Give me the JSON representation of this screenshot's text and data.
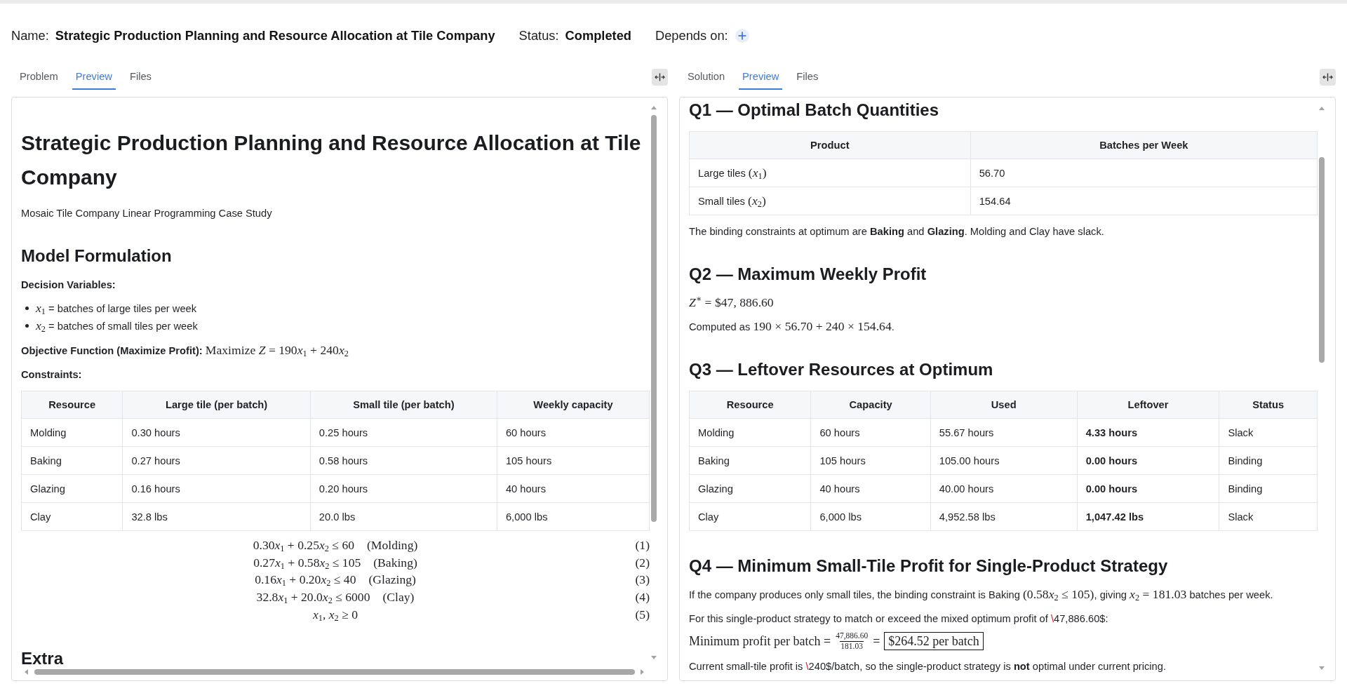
{
  "header": {
    "name_label": "Name:",
    "name": "Strategic Production Planning and Resource Allocation at Tile Company",
    "status_label": "Status:",
    "status": "Completed",
    "depends_label": "Depends on:"
  },
  "left_panel": {
    "tabs": [
      {
        "label": "Problem",
        "selected": false
      },
      {
        "label": "Preview",
        "selected": true
      },
      {
        "label": "Files",
        "selected": false
      }
    ],
    "blocks": [
      {
        "kind": "title",
        "text": "Strategic Production Planning and Resource Allocation at Tile Company"
      },
      {
        "kind": "paragraph",
        "segments": [
          {
            "kind": "text",
            "text": "Mosaic Tile Company Linear Programming Case Study"
          }
        ]
      },
      {
        "kind": "heading",
        "text": "Model Formulation"
      },
      {
        "kind": "label",
        "text": "Decision Variables:"
      },
      {
        "kind": "list",
        "items": [
          {
            "segments": [
              {
                "kind": "math",
                "text": "*x*$_{1}$"
              },
              {
                "kind": "text",
                "text": " = batches of large tiles per week"
              }
            ]
          },
          {
            "segments": [
              {
                "kind": "math",
                "text": "*x*$_{2}$"
              },
              {
                "kind": "text",
                "text": " = batches of small tiles per week"
              }
            ]
          }
        ]
      },
      {
        "kind": "paragraph",
        "segments": [
          {
            "kind": "text",
            "text": "**Objective Function (Maximize Profit):** "
          },
          {
            "kind": "math",
            "text": "Maximize *Z* = 190"
          },
          {
            "kind": "math",
            "text": "*x*$_{1}$ + 240"
          },
          {
            "kind": "math",
            "text": "*x*$_{2}$"
          }
        ]
      },
      {
        "kind": "label",
        "text": "Constraints:"
      },
      {
        "kind": "table",
        "columns": [
          {
            "label": "Resource",
            "emphasis": false
          },
          {
            "label": "Large tile (per batch)",
            "emphasis": false
          },
          {
            "label": "Small tile (per batch)",
            "emphasis": false
          },
          {
            "label": "Weekly capacity",
            "emphasis": false
          }
        ],
        "rows": [
          [
            "Molding",
            "0.30 hours",
            "0.25 hours",
            "60 hours"
          ],
          [
            "Baking",
            "0.27 hours",
            "0.58 hours",
            "105 hours"
          ],
          [
            "Glazing",
            "0.16 hours",
            "0.20 hours",
            "40 hours"
          ],
          [
            "Clay",
            "32.8 lbs",
            "20.0 lbs",
            "6,000 lbs"
          ]
        ]
      },
      {
        "kind": "equations",
        "items": [
          {
            "pieces": [
              "0.30",
              "*x*$_{1}$ + 0.25",
              "*x*$_{2}$ ≤ 60"
            ],
            "tag": "(Molding)",
            "number": "(1)"
          },
          {
            "pieces": [
              "0.27",
              "*x*$_{1}$ + 0.58",
              "*x*$_{2}$ ≤ 105"
            ],
            "tag": "(Baking)",
            "number": "(2)"
          },
          {
            "pieces": [
              "0.16",
              "*x*$_{1}$ + 0.20",
              "*x*$_{2}$ ≤ 40"
            ],
            "tag": "(Glazing)",
            "number": "(3)"
          },
          {
            "pieces": [
              "32.8",
              "*x*$_{1}$ + 20.0",
              "*x*$_{2}$ ≤ 6000"
            ],
            "tag": "(Clay)",
            "number": "(4)"
          },
          {
            "pieces": [
              "*x*$_{1}$, *x*$_{2}$ ≥ 0"
            ],
            "number": "(5)"
          }
        ]
      },
      {
        "kind": "heading",
        "text": "Extra"
      }
    ]
  },
  "right_panel": {
    "tabs": [
      {
        "label": "Solution",
        "selected": false
      },
      {
        "label": "Preview",
        "selected": true
      },
      {
        "label": "Files",
        "selected": false
      }
    ],
    "blocks": [
      {
        "kind": "heading",
        "text": "Q1 — Optimal Batch Quantities"
      },
      {
        "kind": "table",
        "columns": [
          {
            "label": "Product",
            "emphasis": false
          },
          {
            "label": "Batches per Week",
            "emphasis": false
          }
        ],
        "rows": [
          [
            [
              {
                "kind": "text",
                "text": "Large tiles "
              },
              {
                "kind": "math",
                "text": "(*x*$_{1}$)"
              }
            ],
            "56.70"
          ],
          [
            [
              {
                "kind": "text",
                "text": "Small tiles "
              },
              {
                "kind": "math",
                "text": "(*x*$_{2}$)"
              }
            ],
            "154.64"
          ]
        ]
      },
      {
        "kind": "paragraph",
        "segments": [
          {
            "kind": "text",
            "text": "The binding constraints at optimum are **Baking** and **Glazing**. Molding and Clay have slack."
          }
        ]
      },
      {
        "kind": "heading",
        "text": "Q2 — Maximum Weekly Profit"
      },
      {
        "kind": "paragraph",
        "segments": [
          {
            "kind": "math",
            "text": "*Z*$^{∗}$ = $47, 886.60"
          }
        ]
      },
      {
        "kind": "paragraph",
        "segments": [
          {
            "kind": "text",
            "text": "Computed as "
          },
          {
            "kind": "math",
            "text": "190 × 56.70 + 240 × 154.64"
          },
          {
            "kind": "text",
            "text": "."
          }
        ]
      },
      {
        "kind": "heading",
        "text": "Q3 — Leftover Resources at Optimum"
      },
      {
        "kind": "table",
        "columns": [
          {
            "label": "Resource",
            "emphasis": false
          },
          {
            "label": "Capacity",
            "emphasis": false
          },
          {
            "label": "Used",
            "emphasis": false
          },
          {
            "label": "Leftover",
            "emphasis": true
          },
          {
            "label": "Status",
            "emphasis": false
          }
        ],
        "rows": [
          [
            "Molding",
            "60 hours",
            "55.67 hours",
            "4.33 hours",
            "Slack"
          ],
          [
            "Baking",
            "105 hours",
            "105.00 hours",
            "0.00 hours",
            "Binding"
          ],
          [
            "Glazing",
            "40 hours",
            "40.00 hours",
            "0.00 hours",
            "Binding"
          ],
          [
            "Clay",
            "6,000 lbs",
            "4,952.58 lbs",
            "1,047.42 lbs",
            "Slack"
          ]
        ]
      },
      {
        "kind": "heading",
        "text": "Q4 — Minimum Small-Tile Profit for Single-Product Strategy"
      },
      {
        "kind": "paragraph",
        "segments": [
          {
            "kind": "text",
            "text": "If the company produces only small tiles, the binding constraint is Baking "
          },
          {
            "kind": "math",
            "text": "(0.58"
          },
          {
            "kind": "math",
            "text": "*x*$_{2}$ ≤ 105)"
          },
          {
            "kind": "text",
            "text": ", giving "
          },
          {
            "kind": "math",
            "text": "*x*$_{2}$ = 181.03"
          },
          {
            "kind": "text",
            "text": " batches per week."
          }
        ]
      },
      {
        "kind": "paragraph",
        "segments": [
          {
            "kind": "text",
            "text": "For this single-product strategy to match or exceed the mixed optimum profit of "
          },
          {
            "kind": "error",
            "text": "\\"
          },
          {
            "kind": "text",
            "text": "47,886.60$:"
          }
        ]
      },
      {
        "kind": "formula",
        "parts": [
          {
            "kind": "text",
            "text": "Minimum profit per batch ="
          },
          {
            "kind": "fraction",
            "numerator": "47,886.60",
            "denominator": "181.03"
          },
          {
            "kind": "text",
            "text": "="
          },
          {
            "kind": "boxed",
            "text": "$264.52 per batch"
          }
        ]
      },
      {
        "kind": "paragraph",
        "segments": [
          {
            "kind": "text",
            "text": "Current small-tile profit is "
          },
          {
            "kind": "error",
            "text": "\\"
          },
          {
            "kind": "text",
            "text": "240$/batch, so the single-product strategy is **not** optimal under current pricing."
          }
        ]
      }
    ]
  }
}
